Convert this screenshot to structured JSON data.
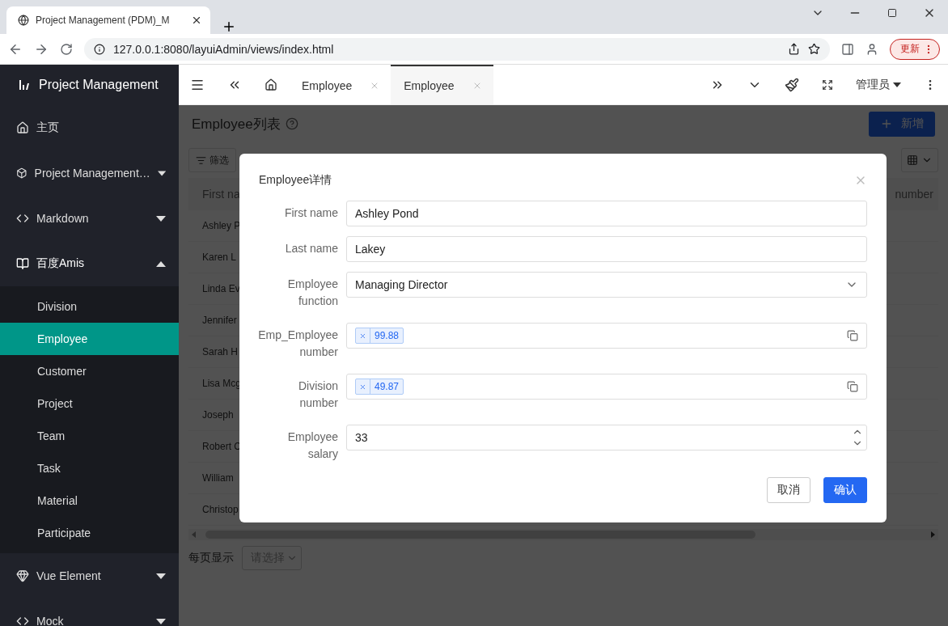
{
  "browser": {
    "tab_title": "Project Management (PDM)_M",
    "url": "127.0.0.1:8080/layuiAdmin/views/index.html",
    "update_label": "更新"
  },
  "sidebar": {
    "title": "Project Management",
    "items": [
      {
        "label": "主页",
        "kind": "link"
      },
      {
        "label": "Project Management…",
        "kind": "group",
        "expanded": false
      },
      {
        "label": "Markdown",
        "kind": "group",
        "expanded": false
      },
      {
        "label": "百度Amis",
        "kind": "group",
        "expanded": true,
        "children": [
          {
            "label": "Division",
            "selected": false
          },
          {
            "label": "Employee",
            "selected": true
          },
          {
            "label": "Customer",
            "selected": false
          },
          {
            "label": "Project",
            "selected": false
          },
          {
            "label": "Team",
            "selected": false
          },
          {
            "label": "Task",
            "selected": false
          },
          {
            "label": "Material",
            "selected": false
          },
          {
            "label": "Participate",
            "selected": false
          }
        ]
      },
      {
        "label": "Vue Element",
        "kind": "group",
        "expanded": false
      },
      {
        "label": "Mock",
        "kind": "group",
        "expanded": false
      }
    ]
  },
  "header": {
    "tabs": [
      {
        "label": "Employee",
        "selected": false
      },
      {
        "label": "Employee",
        "selected": true
      }
    ],
    "user": "管理员"
  },
  "page": {
    "title": "Employee列表",
    "add_button": "新增",
    "filter_button": "筛选",
    "columns": [
      "First na",
      "number"
    ],
    "rows": [
      "Ashley P",
      "Karen L",
      "Linda Ev",
      "Jennifer",
      "Sarah H",
      "Lisa Mcg",
      "Joseph",
      "Robert C",
      "William",
      "Christop"
    ],
    "per_page_label": "每页显示",
    "per_page_placeholder": "请选择"
  },
  "dialog": {
    "title": "Employee详情",
    "fields": [
      {
        "label": "First name",
        "kind": "text",
        "value": "Ashley Pond"
      },
      {
        "label": "Last name",
        "kind": "text",
        "value": "Lakey"
      },
      {
        "label": "Employee function",
        "kind": "select",
        "value": "Managing Director"
      },
      {
        "label": "Emp_Employee number",
        "kind": "tags",
        "tags": [
          "99.88"
        ]
      },
      {
        "label": "Division number",
        "kind": "tags",
        "tags": [
          "49.87"
        ]
      },
      {
        "label": "Employee salary",
        "kind": "number",
        "value": "33"
      }
    ],
    "cancel": "取消",
    "confirm": "确认"
  }
}
